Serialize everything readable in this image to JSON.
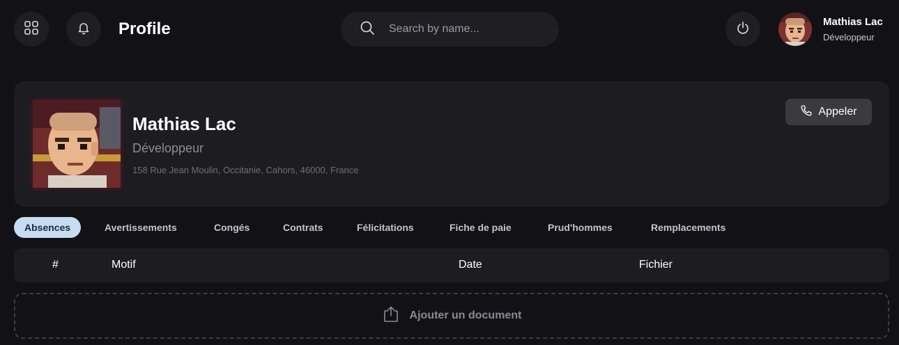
{
  "header": {
    "title": "Profile",
    "search_placeholder": "Search by name...",
    "user": {
      "name": "Mathias Lac",
      "role": "Développeur"
    },
    "icons": [
      "grid-icon",
      "bell-icon",
      "search-icon",
      "power-icon"
    ]
  },
  "profile": {
    "name": "Mathias Lac",
    "role": "Développeur",
    "address": "158 Rue Jean Moulin, Occitanie, Cahors, 46000, France",
    "call_label": "Appeler"
  },
  "tabs": [
    {
      "label": "Absences",
      "active": true
    },
    {
      "label": "Avertissements",
      "active": false
    },
    {
      "label": "Congés",
      "active": false
    },
    {
      "label": "Contrats",
      "active": false
    },
    {
      "label": "Félicitations",
      "active": false
    },
    {
      "label": "Fiche de paie",
      "active": false
    },
    {
      "label": "Prud'hommes",
      "active": false
    },
    {
      "label": "Remplacements",
      "active": false
    }
  ],
  "table": {
    "columns": [
      "#",
      "Motif",
      "Date",
      "Fichier"
    ],
    "rows": []
  },
  "upload": {
    "label": "Ajouter un document"
  },
  "colors": {
    "background": "#121116",
    "card": "#1d1d21",
    "active_tab": "#c6dcf2"
  }
}
